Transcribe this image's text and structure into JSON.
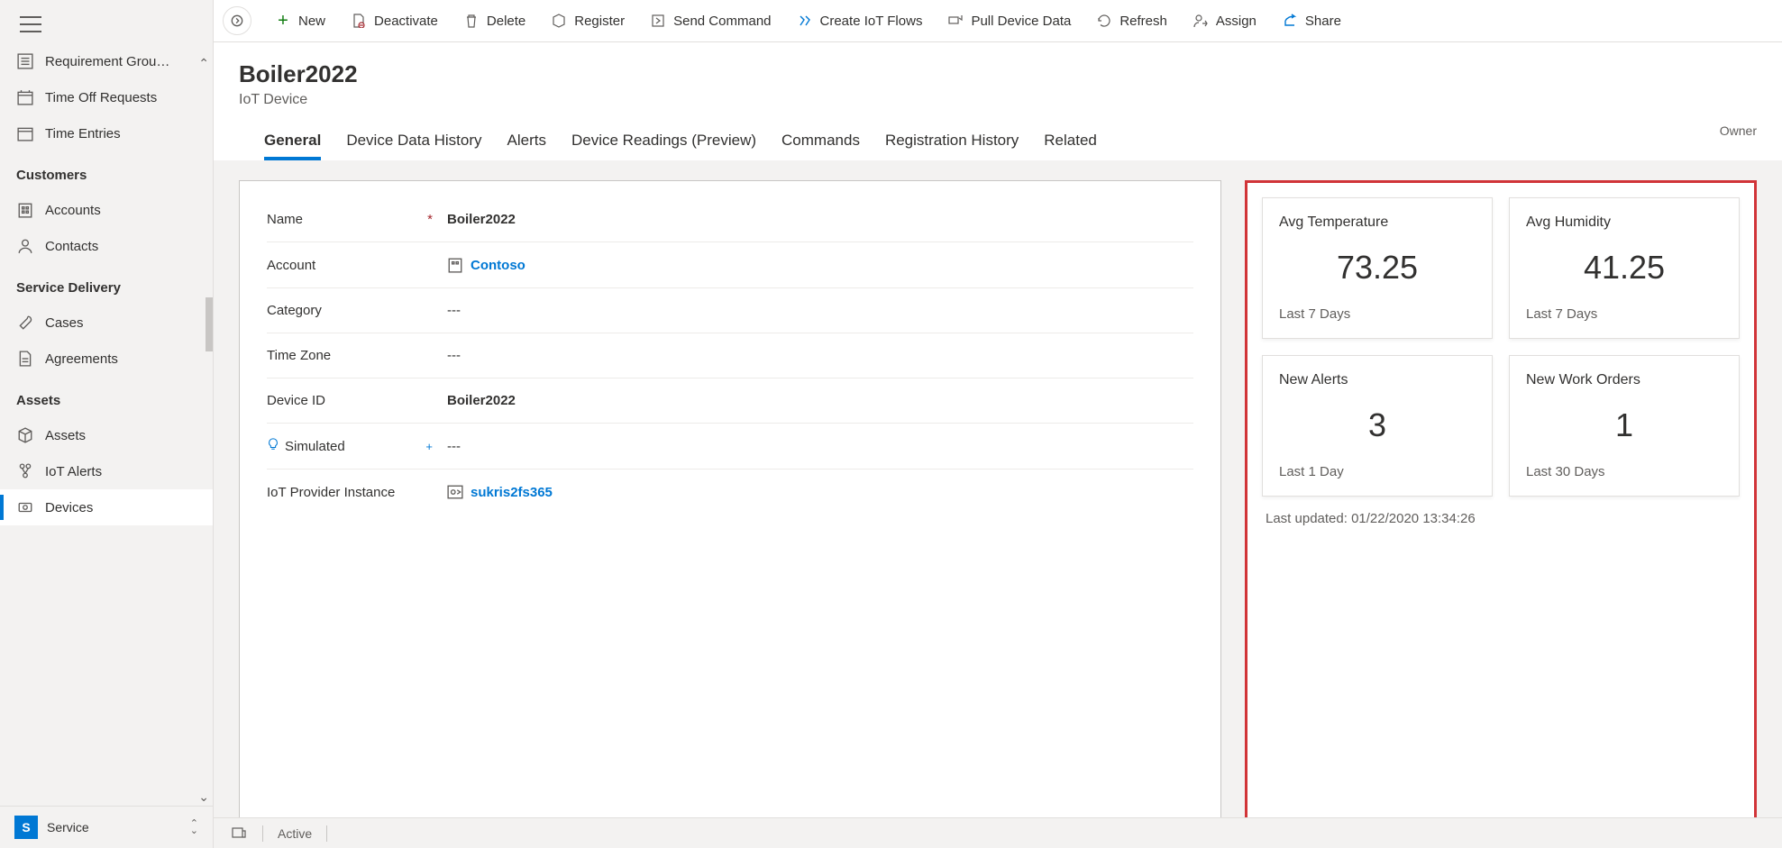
{
  "sidebar": {
    "items": [
      {
        "label": "Requirement Grou…",
        "icon": "requirement"
      },
      {
        "label": "Time Off Requests",
        "icon": "calendar-x"
      },
      {
        "label": "Time Entries",
        "icon": "calendar"
      }
    ],
    "sections": [
      {
        "title": "Customers",
        "items": [
          {
            "label": "Accounts",
            "icon": "building"
          },
          {
            "label": "Contacts",
            "icon": "contact"
          }
        ]
      },
      {
        "title": "Service Delivery",
        "items": [
          {
            "label": "Cases",
            "icon": "wrench"
          },
          {
            "label": "Agreements",
            "icon": "document"
          }
        ]
      },
      {
        "title": "Assets",
        "items": [
          {
            "label": "Assets",
            "icon": "cube"
          },
          {
            "label": "IoT Alerts",
            "icon": "alert"
          },
          {
            "label": "Devices",
            "icon": "device",
            "active": true
          }
        ]
      }
    ],
    "app_badge": "S",
    "app_name": "Service"
  },
  "commands": [
    {
      "label": "New",
      "icon": "plus",
      "iconClass": "green"
    },
    {
      "label": "Deactivate",
      "icon": "deactivate",
      "iconClass": "gray"
    },
    {
      "label": "Delete",
      "icon": "trash",
      "iconClass": "gray"
    },
    {
      "label": "Register",
      "icon": "register",
      "iconClass": "gray"
    },
    {
      "label": "Send Command",
      "icon": "send",
      "iconClass": "gray"
    },
    {
      "label": "Create IoT Flows",
      "icon": "flows",
      "iconClass": "blue"
    },
    {
      "label": "Pull Device Data",
      "icon": "pull",
      "iconClass": "gray"
    },
    {
      "label": "Refresh",
      "icon": "refresh",
      "iconClass": "gray"
    },
    {
      "label": "Assign",
      "icon": "assign",
      "iconClass": "gray"
    },
    {
      "label": "Share",
      "icon": "share",
      "iconClass": "blue"
    }
  ],
  "header": {
    "title": "Boiler2022",
    "subtitle": "IoT Device",
    "owner_label": "Owner"
  },
  "tabs": [
    {
      "label": "General",
      "active": true
    },
    {
      "label": "Device Data History"
    },
    {
      "label": "Alerts"
    },
    {
      "label": "Device Readings (Preview)"
    },
    {
      "label": "Commands"
    },
    {
      "label": "Registration History"
    },
    {
      "label": "Related"
    }
  ],
  "form": {
    "name": {
      "label": "Name",
      "value": "Boiler2022",
      "required": true
    },
    "account": {
      "label": "Account",
      "value": "Contoso",
      "isLookup": true
    },
    "category": {
      "label": "Category",
      "value": "---"
    },
    "timezone": {
      "label": "Time Zone",
      "value": "---"
    },
    "deviceid": {
      "label": "Device ID",
      "value": "Boiler2022"
    },
    "simulated": {
      "label": "Simulated",
      "value": "---",
      "hint": true
    },
    "provider": {
      "label": "IoT Provider Instance",
      "value": "sukris2fs365",
      "isLookup": true
    }
  },
  "dashboard": {
    "cards": [
      {
        "title": "Avg Temperature",
        "value": "73.25",
        "sub": "Last 7 Days"
      },
      {
        "title": "Avg Humidity",
        "value": "41.25",
        "sub": "Last 7 Days"
      },
      {
        "title": "New Alerts",
        "value": "3",
        "sub": "Last 1 Day"
      },
      {
        "title": "New Work Orders",
        "value": "1",
        "sub": "Last 30 Days"
      }
    ],
    "updated": "Last updated: 01/22/2020 13:34:26"
  },
  "footer": {
    "status": "Active"
  }
}
